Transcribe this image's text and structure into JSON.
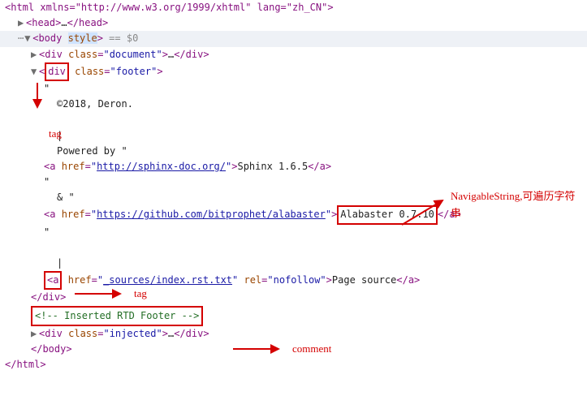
{
  "root_open": "<html xmlns=\"http://www.w3.org/1999/xhtml\" lang=\"zh_CN\">",
  "head_line": {
    "open": "<head>",
    "ell": "…",
    "close": "</head>"
  },
  "body_open": {
    "open": "<body ",
    "style_attr": "style",
    "close": ">",
    "eq": " == $0"
  },
  "div_document": {
    "open": "<div ",
    "cls_attr": "class",
    "cls_val": "\"document\"",
    "gt": ">",
    "ell": "…",
    "close": "</div>"
  },
  "div_footer": {
    "open": "<",
    "div": "div",
    "space": " ",
    "cls_attr": "class",
    "eq": "=",
    "cls_val": "\"footer\"",
    "gt": ">"
  },
  "quote": "\"",
  "copyright": "©2018, Deron.",
  "pipe": "|",
  "powered": "Powered by \"",
  "a1": {
    "open": "<a ",
    "href": "href",
    "eq": "=",
    "q": "\"",
    "url": "http://sphinx-doc.org/",
    "q2": "\"",
    "gt": ">",
    "text": "Sphinx 1.6.5",
    "close": "</a>"
  },
  "amp": "& \"",
  "a2": {
    "open": "<a ",
    "href": "href",
    "eq": "=",
    "q": "\"",
    "url": "https://github.com/bitprophet/alabaster",
    "q2": "\"",
    "gt": ">",
    "text": "Alabaster 0.7.10",
    "close": "</a>"
  },
  "a3": {
    "open": "<",
    "a": "a",
    "space": " ",
    "href": "href",
    "eq": "=",
    "q": "\"",
    "url": "_sources/index.rst.txt",
    "q2": "\" ",
    "rel": "rel",
    "eq2": "=",
    "relval": "\"nofollow\"",
    "gt": ">",
    "text": "Page source",
    "close": "</a>"
  },
  "div_close": "</div>",
  "comment": "<!-- Inserted RTD Footer -->",
  "div_injected": {
    "open": "<div ",
    "cls_attr": "class",
    "eq": "=",
    "cls_val": "\"injected\"",
    "gt": ">",
    "ell": "…",
    "close": "</div>"
  },
  "body_close": "</body>",
  "html_close": "</html>",
  "anno": {
    "tag": "tag",
    "tag2": "tag",
    "ns": "NavigableString,可遍历字符串",
    "comment": "comment"
  }
}
